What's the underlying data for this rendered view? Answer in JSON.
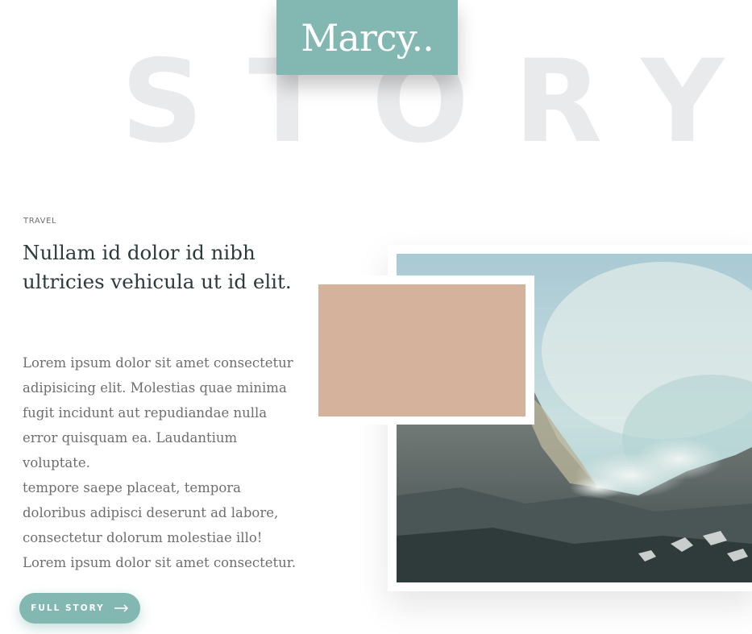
{
  "background_word": "STORY",
  "brand": {
    "name": "Marcy..",
    "color": "#82b8b1"
  },
  "article": {
    "category": "TRAVEL",
    "headline": "Nullam id dolor id nibh ultricies vehicula ut id elit.",
    "paragraphs": [
      "Lorem ipsum dolor sit amet consectetur adipisicing elit. Molestias quae minima fugit incidunt aut repudiandae nulla error quisquam ea. Laudantium voluptate.",
      "tempore saepe placeat, tempora doloribus adipisci deserunt ad labore, consectetur dolorum molestiae illo! Lorem ipsum dolor sit amet consectetur."
    ],
    "cta_label": "FULL STORY",
    "cta_icon": "arrow-right-icon"
  },
  "media": {
    "photo_icon": "volcano-landscape-photo",
    "swatch_color": "#d5b29c"
  }
}
